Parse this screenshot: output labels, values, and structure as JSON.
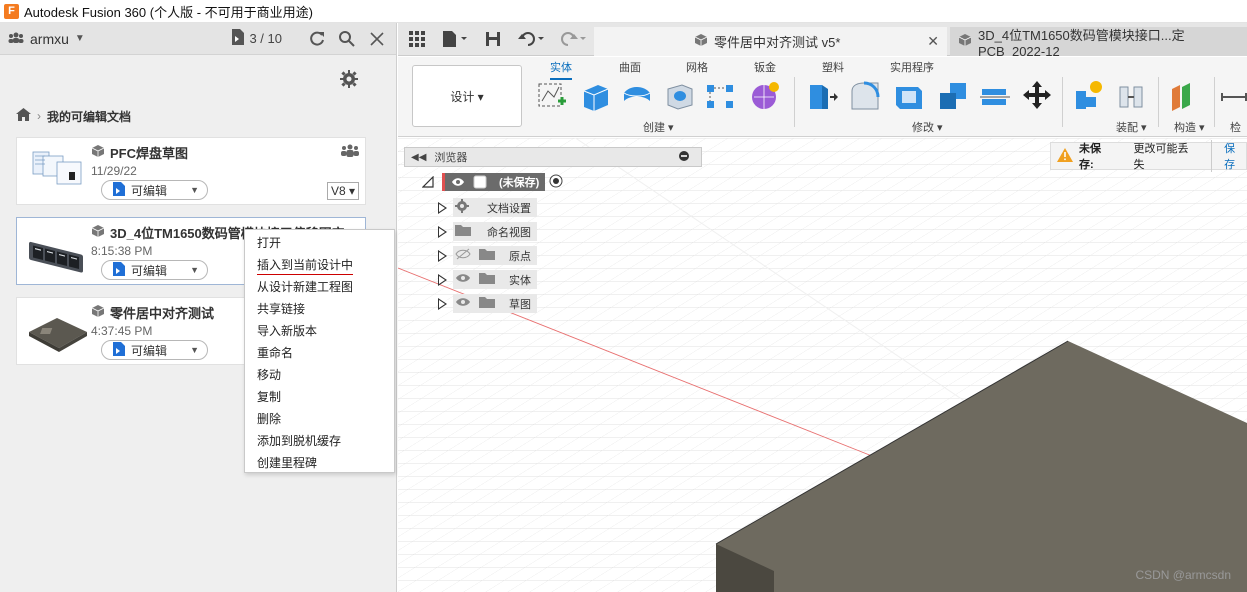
{
  "window": {
    "title": "Autodesk Fusion 360 (个人版 - 不可用于商业用途)",
    "logo": "F"
  },
  "data_panel": {
    "user": "armxu",
    "doc_count": "3 / 10",
    "breadcrumb": "我的可编辑文档",
    "cards": [
      {
        "title": "PFC焊盘草图",
        "date": "11/29/22",
        "edit_label": "可编辑",
        "version": "V8"
      },
      {
        "title": "3D_4位TM1650数码管模块接口偏移固定",
        "date": "8:15:38 PM",
        "edit_label": "可编辑"
      },
      {
        "title": "零件居中对齐测试",
        "date": "4:37:45 PM",
        "edit_label": "可编辑"
      }
    ],
    "context_menu": [
      "打开",
      "插入到当前设计中",
      "从设计新建工程图",
      "共享链接",
      "导入新版本",
      "重命名",
      "移动",
      "复制",
      "删除",
      "添加到脱机缓存",
      "创建里程碑"
    ]
  },
  "workspace": {
    "tabs": [
      {
        "label": "零件居中对齐测试 v5*"
      },
      {
        "label": "3D_4位TM1650数码管模块接口...定PCB_2022-12"
      }
    ],
    "design_button": "设计 ▾",
    "ribbon_tabs": [
      "实体",
      "曲面",
      "网格",
      "钣金",
      "塑料",
      "实用程序"
    ],
    "groups": {
      "create": "创建 ▾",
      "modify": "修改 ▾",
      "assemble": "装配 ▾",
      "construct": "构造 ▾",
      "inspect": "检"
    },
    "browser": {
      "title": "浏览器",
      "root": "(未保存)",
      "items": [
        "文档设置",
        "命名视图",
        "原点",
        "实体",
        "草图"
      ]
    },
    "warning": {
      "label": "未保存:",
      "text": "更改可能丢失",
      "save": "保存"
    },
    "watermark": "CSDN @armcsdn"
  }
}
